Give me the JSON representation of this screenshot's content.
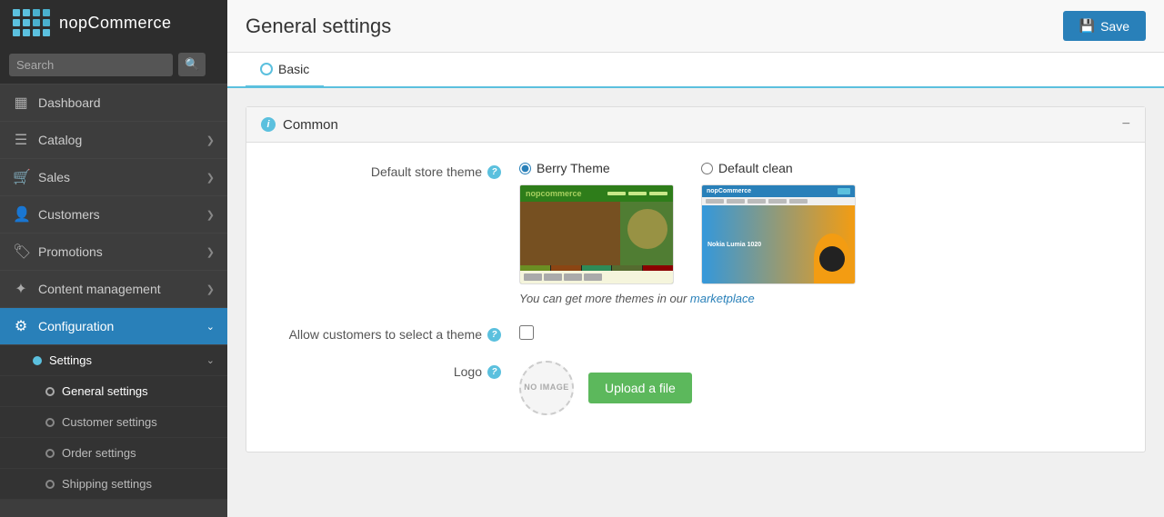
{
  "brand": {
    "name": "nopCommerce"
  },
  "sidebar": {
    "search_placeholder": "Search",
    "items": [
      {
        "id": "dashboard",
        "label": "Dashboard",
        "icon": "▦",
        "has_children": false
      },
      {
        "id": "catalog",
        "label": "Catalog",
        "icon": "☰",
        "has_children": true
      },
      {
        "id": "sales",
        "label": "Sales",
        "icon": "🛒",
        "has_children": true
      },
      {
        "id": "customers",
        "label": "Customers",
        "icon": "👤",
        "has_children": true
      },
      {
        "id": "promotions",
        "label": "Promotions",
        "icon": "🏷",
        "has_children": true
      },
      {
        "id": "content-management",
        "label": "Content management",
        "icon": "⚙",
        "has_children": true
      },
      {
        "id": "configuration",
        "label": "Configuration",
        "icon": "⚙",
        "has_children": true,
        "active": true
      }
    ],
    "sub_items": [
      {
        "id": "settings",
        "label": "Settings",
        "active": true
      },
      {
        "id": "general-settings",
        "label": "General settings",
        "active_sub": true
      },
      {
        "id": "customer-settings",
        "label": "Customer settings"
      },
      {
        "id": "order-settings",
        "label": "Order settings"
      },
      {
        "id": "shipping-settings",
        "label": "Shipping settings"
      }
    ]
  },
  "header": {
    "title": "General settings",
    "save_label": "Save"
  },
  "tabs": [
    {
      "id": "basic",
      "label": "Basic",
      "active": true
    }
  ],
  "common_section": {
    "title": "Common",
    "collapse_symbol": "−",
    "fields": {
      "default_theme": {
        "label": "Default store theme",
        "options": [
          {
            "value": "berry",
            "label": "Berry Theme",
            "selected": true
          },
          {
            "value": "default-clean",
            "label": "Default clean",
            "selected": false
          }
        ],
        "marketplace_text": "You can get more themes in our",
        "marketplace_link_text": "marketplace",
        "marketplace_url": "#"
      },
      "allow_select_theme": {
        "label": "Allow customers to select a theme",
        "checked": false
      },
      "logo": {
        "label": "Logo",
        "no_image_text": "NO IMAGE",
        "upload_label": "Upload a file"
      }
    }
  }
}
